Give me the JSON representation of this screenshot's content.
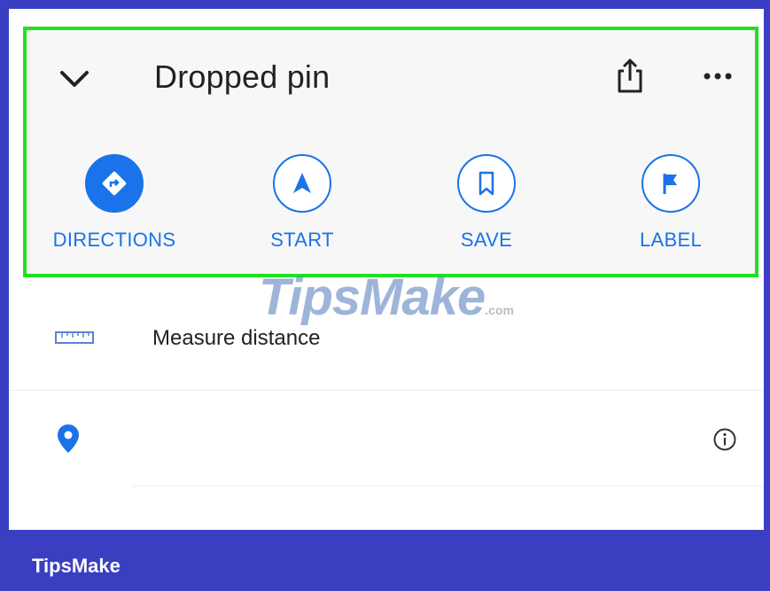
{
  "sheet": {
    "title": "Dropped pin",
    "icons": {
      "collapse": "chevron-down-icon",
      "share": "share-icon",
      "more": "more-horizontal-icon"
    }
  },
  "actions": [
    {
      "label": "DIRECTIONS",
      "icon": "directions-icon",
      "filled": true
    },
    {
      "label": "START",
      "icon": "navigation-arrow-icon",
      "filled": false
    },
    {
      "label": "SAVE",
      "icon": "bookmark-icon",
      "filled": false
    },
    {
      "label": "LABEL",
      "icon": "flag-icon",
      "filled": false
    }
  ],
  "list": {
    "measure": {
      "label": "Measure distance",
      "icon": "ruler-icon"
    },
    "pin": {
      "icon": "location-pin-icon",
      "info_icon": "info-icon"
    }
  },
  "watermark": {
    "main": "TipsMake",
    "suffix": ".com"
  },
  "footer": {
    "brand": "TipsMake"
  },
  "colors": {
    "accent": "#1a73e8",
    "highlight_border": "#20e020",
    "frame_background": "#3a3fc1",
    "text": "#222222"
  }
}
